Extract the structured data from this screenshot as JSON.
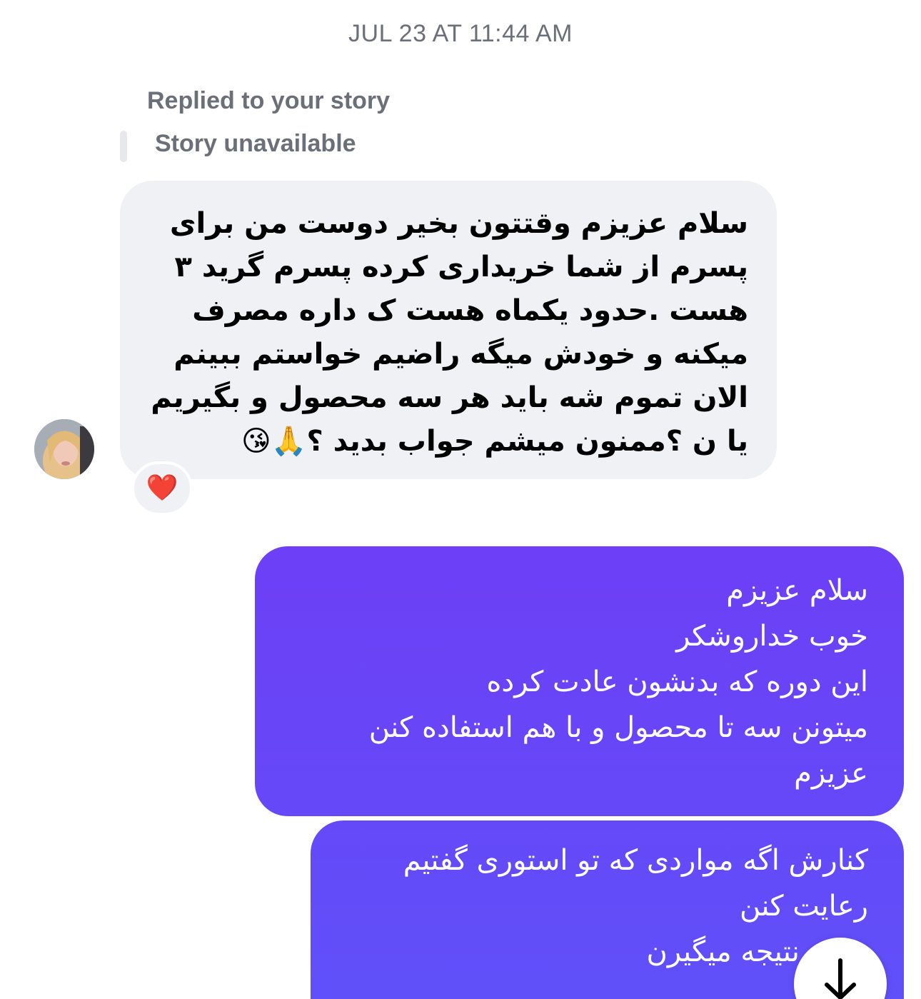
{
  "conversation": {
    "timestamp": "JUL 23 AT 11:44 AM",
    "reply_context": {
      "label": "Replied to your story",
      "story_status": "Story unavailable"
    },
    "incoming_message": {
      "text": "سلام عزیزم وقتتون بخیر دوست من برای\nپسرم از شما خریداری کرده پسرم گرید ۳\nهست .حدود یکماه هست ک داره مصرف\nمیکنه و خودش میگه راضیم خواستم ببینم\nالان تموم شه باید هر سه محصول  و بگیریم\nیا ن ؟ممنون میشم جواب بدید ؟🙏😘",
      "reaction": "❤️"
    },
    "outgoing_messages": [
      {
        "text": "سلام عزیزم\nخوب خداروشکر\nاین دوره که بدنشون عادت کرده\nمیتونن سه تا محصول و با هم استفاده کنن\nعزیزم"
      },
      {
        "text": "کنارش اگه مواردی که تو استوری گفتیم\nرعایت کنن\nخیلی نتیجه میگیرن"
      }
    ],
    "scroll_button_icon": "arrow-down-icon"
  },
  "colors": {
    "incoming_bubble": "#eff1f4",
    "outgoing_bubble": "#6549f8",
    "meta_text": "#6b6f78"
  }
}
